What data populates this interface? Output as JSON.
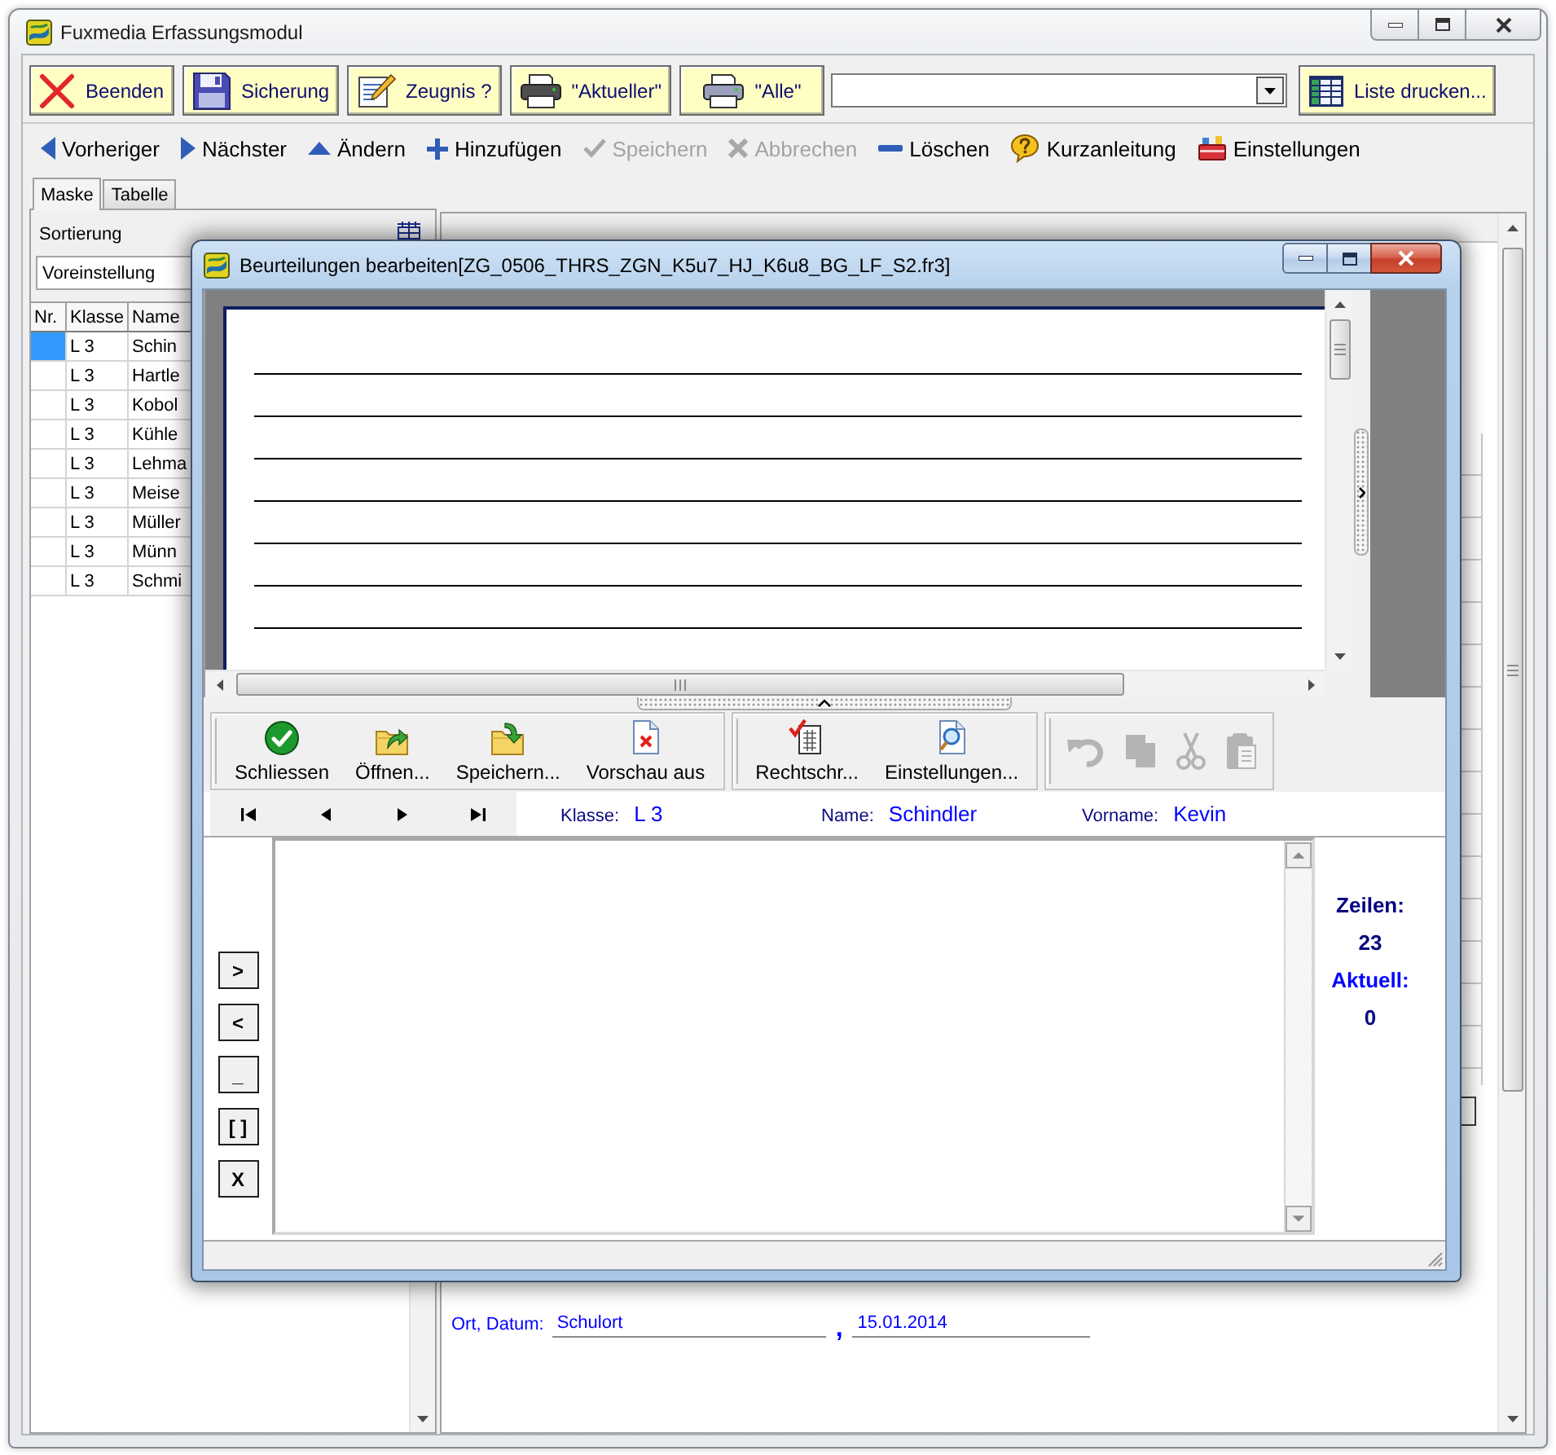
{
  "window": {
    "title": "Fuxmedia Erfassungsmodul"
  },
  "toolbar": {
    "buttons": [
      {
        "kind": "exit",
        "label": "Beenden"
      },
      {
        "kind": "backup",
        "label": "Sicherung"
      },
      {
        "kind": "certificate",
        "label": "Zeugnis ?"
      },
      {
        "kind": "print-current",
        "label": "\"Aktueller\""
      },
      {
        "kind": "print-all",
        "label": "\"Alle\""
      }
    ],
    "list_button": {
      "kind": "list",
      "label": "Liste drucken..."
    }
  },
  "navigation": [
    {
      "kind": "prev",
      "label": "Vorheriger",
      "disabled": false
    },
    {
      "kind": "next",
      "label": "Nächster",
      "disabled": false
    },
    {
      "kind": "edit",
      "label": "Ändern",
      "disabled": false
    },
    {
      "kind": "add",
      "label": "Hinzufügen",
      "disabled": false
    },
    {
      "kind": "save",
      "label": "Speichern",
      "disabled": true
    },
    {
      "kind": "cancel",
      "label": "Abbrechen",
      "disabled": true
    },
    {
      "kind": "delete",
      "label": "Löschen",
      "disabled": false
    },
    {
      "kind": "help",
      "label": "Kurzanleitung",
      "disabled": false
    },
    {
      "kind": "settings",
      "label": "Einstellungen",
      "disabled": false
    }
  ],
  "tabs": [
    {
      "label": "Maske",
      "selected": true
    },
    {
      "label": "Tabelle",
      "selected": false
    }
  ],
  "left_panel": {
    "sort_label": "Sortierung",
    "sort_value": "Voreinstellung",
    "columns": [
      "Nr.",
      "Klasse",
      "Name"
    ],
    "rows": [
      {
        "selected": true,
        "klasse": "L 3",
        "name": "Schin"
      },
      {
        "selected": false,
        "klasse": "L 3",
        "name": "Hartle"
      },
      {
        "selected": false,
        "klasse": "L 3",
        "name": "Kobol"
      },
      {
        "selected": false,
        "klasse": "L 3",
        "name": "Kühle"
      },
      {
        "selected": false,
        "klasse": "L 3",
        "name": "Lehma"
      },
      {
        "selected": false,
        "klasse": "L 3",
        "name": "Meise"
      },
      {
        "selected": false,
        "klasse": "L 3",
        "name": "Müller"
      },
      {
        "selected": false,
        "klasse": "L 3",
        "name": "Münn"
      },
      {
        "selected": false,
        "klasse": "L 3",
        "name": "Schmi"
      }
    ]
  },
  "place_date": {
    "label": "Ort, Datum:",
    "place": "Schulort",
    "separator": ",",
    "date": "15.01.2014"
  },
  "dialog": {
    "title": "Beurteilungen bearbeiten[ZG_0506_THRS_ZGN_K5u7_HJ_K6u8_BG_LF_S2.fr3]",
    "toolbar_groups": [
      {
        "buttons": [
          {
            "kind": "close",
            "label": "Schliessen",
            "disabled": false
          },
          {
            "kind": "open",
            "label": "Öffnen...",
            "disabled": false
          },
          {
            "kind": "save",
            "label": "Speichern...",
            "disabled": false
          },
          {
            "kind": "preview",
            "label": "Vorschau aus",
            "disabled": false
          }
        ]
      },
      {
        "buttons": [
          {
            "kind": "spellcheck",
            "label": "Rechtschr...",
            "disabled": false
          },
          {
            "kind": "settings",
            "label": "Einstellungen...",
            "disabled": false
          }
        ]
      },
      {
        "buttons": [
          {
            "kind": "undo",
            "disabled": true
          },
          {
            "kind": "copy",
            "disabled": true
          },
          {
            "kind": "cut",
            "disabled": true
          },
          {
            "kind": "paste",
            "disabled": true
          }
        ]
      }
    ],
    "record_fields": [
      {
        "label": "Klasse:",
        "value": "L 3"
      },
      {
        "label": "Name:",
        "value": "Schindler"
      },
      {
        "label": "Vorname:",
        "value": "Kevin"
      }
    ],
    "side_buttons": [
      ">",
      "<",
      "_",
      "[ ]",
      "X"
    ],
    "stats": [
      {
        "label": "Zeilen:",
        "value": "23",
        "color": "#000080"
      },
      {
        "label": "Aktuell:",
        "value": "0",
        "color": "#0000ff"
      }
    ]
  }
}
